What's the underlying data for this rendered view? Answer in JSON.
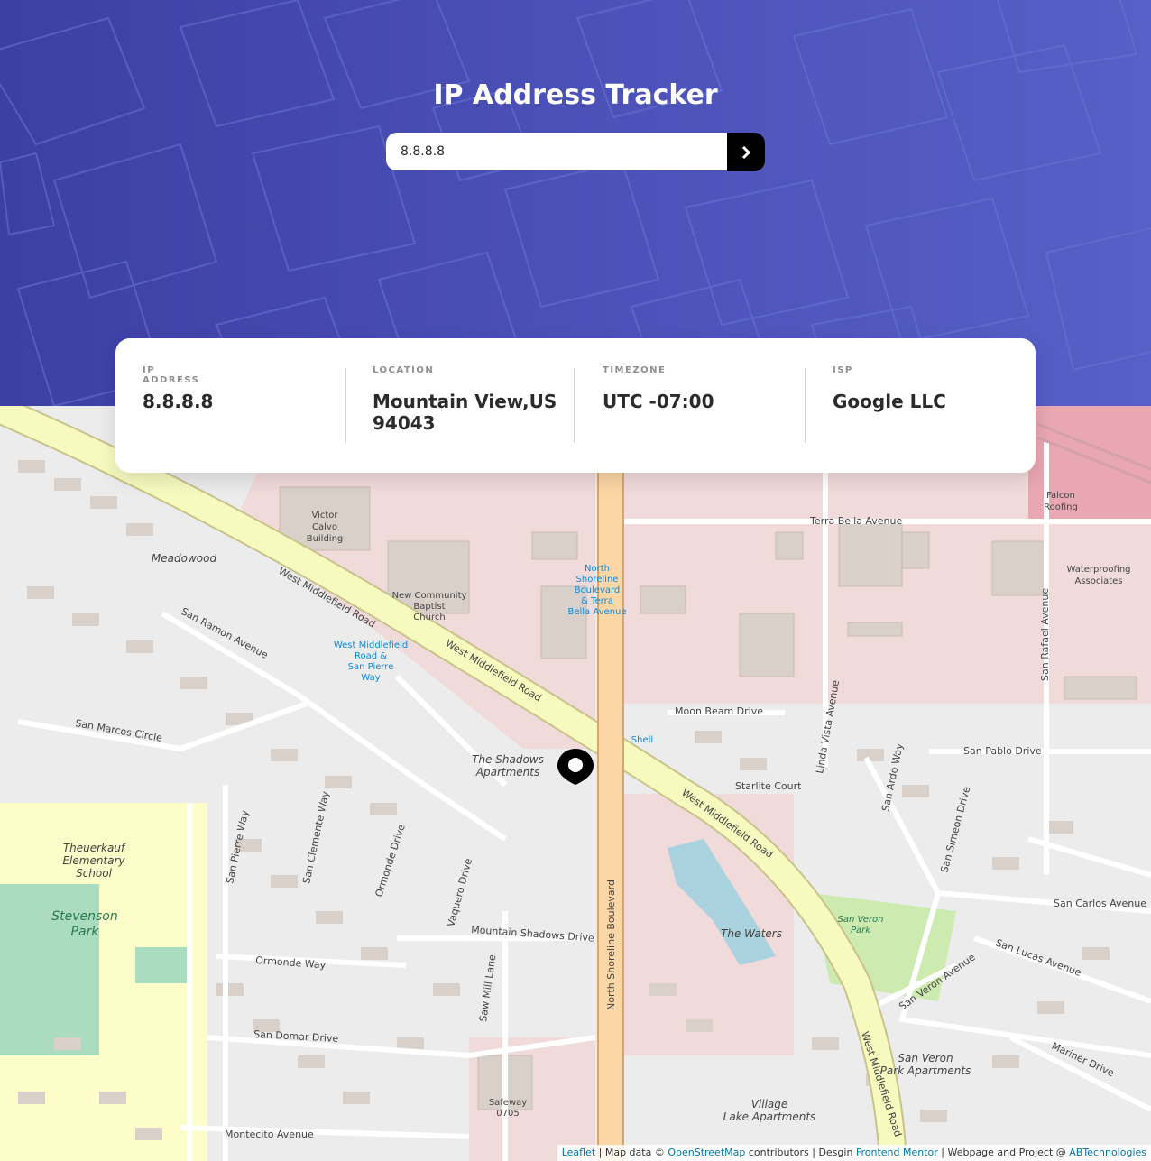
{
  "header": {
    "title": "IP Address Tracker",
    "search_value": "8.8.8.8",
    "submit_icon": "chevron-right-icon",
    "accent_color": "#4a4fb6"
  },
  "info": {
    "ip_label": "IP ADDRESS",
    "ip_value": "8.8.8.8",
    "location_label": "LOCATION",
    "location_value_line1": "Mountain View,US",
    "location_value_line2": "94043",
    "timezone_label": "TIMEZONE",
    "timezone_value": "UTC -07:00",
    "isp_label": "ISP",
    "isp_value": "Google LLC"
  },
  "map": {
    "marker_icon": "location-marker-icon",
    "streets": {
      "west_middlefield": "West Middlefield Road",
      "north_shoreline": "North Shoreline Boulevard",
      "terra_bella": "Terra Bella Avenue",
      "moon_beam": "Moon Beam Drive",
      "linda_vista": "Linda Vista Avenue",
      "san_pablo": "San Pablo Drive",
      "san_ramon": "San Ramon Avenue",
      "san_marcos_circle": "San Marcos Circle",
      "ormonde_way": "Ormonde Way",
      "ormonde_drive": "Ormonde Drive",
      "mountain_shadows": "Mountain Shadows Drive",
      "san_domar": "San Domar Drive",
      "montecito": "Montecito Avenue",
      "san_pierre": "San Pierre Way",
      "san_clemente": "San Clemente Way",
      "vaquero": "Vaquero Drive",
      "saw_mill": "Saw Mill Lane",
      "san_veron": "San Veron Avenue",
      "san_lucas": "San Lucas Avenue",
      "san_carlos": "San Carlos Avenue",
      "san_rafael": "San Rafael Avenue",
      "san_ardo": "San Ardo Way",
      "san_simeon": "San Simeon Drive",
      "mariner": "Mariner Drive",
      "starlite": "Starlite Court"
    },
    "places": {
      "victor_calvo": [
        "Victor",
        "Calvo",
        "Building"
      ],
      "church": [
        "New Community",
        "Baptist",
        "Church"
      ],
      "bus_stop": [
        "West Middlefield",
        "Road &",
        "San Pierre",
        "Way"
      ],
      "bus_stop_2": [
        "North",
        "Shoreline",
        "Boulevard",
        "& Terra",
        "Bella Avenue"
      ],
      "meadowood": "Meadowood",
      "shadows_apts": [
        "The Shadows",
        "Apartments"
      ],
      "theuerkauf": [
        "Theuerkauf",
        "Elementary",
        "School"
      ],
      "stevenson": [
        "Stevenson",
        "Park"
      ],
      "waters": "The Waters",
      "san_veron_park": [
        "San Veron",
        "Park"
      ],
      "san_veron_apts": [
        "San Veron",
        "Park Apartments"
      ],
      "village_lake": [
        "Village",
        "Lake Apartments"
      ],
      "safeway": [
        "Safeway",
        "0705"
      ],
      "falcon": [
        "Falcon",
        "Roofing"
      ],
      "waterproofing": [
        "Waterproofing",
        "Associates"
      ],
      "shell": "Shell"
    }
  },
  "attribution": {
    "leaflet": "Leaflet",
    "sep1": " | Map data © ",
    "osm": "OpenStreetMap",
    "sep2": " contributors | Desgin ",
    "frontend": "Frontend Mentor",
    "sep3": " | Webpage and Project @ ",
    "author": "ABTechnologies"
  }
}
